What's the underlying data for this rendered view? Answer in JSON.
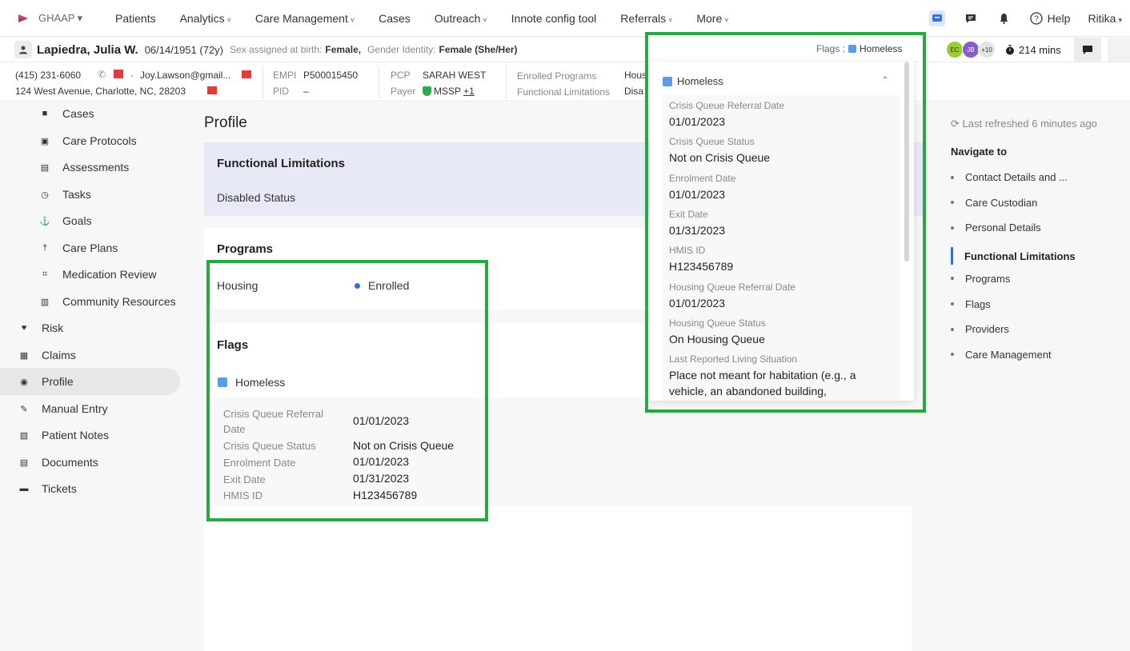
{
  "nav": {
    "brand": "GHAAP",
    "items": [
      {
        "label": "Patients",
        "caret": false
      },
      {
        "label": "Analytics",
        "caret": true
      },
      {
        "label": "Care Management",
        "caret": true
      },
      {
        "label": "Cases",
        "caret": false
      },
      {
        "label": "Outreach",
        "caret": true
      },
      {
        "label": "Innote config tool",
        "caret": false
      },
      {
        "label": "Referrals",
        "caret": true
      },
      {
        "label": "More",
        "caret": true
      }
    ],
    "help": "Help",
    "user": "Ritika"
  },
  "patient": {
    "name": "Lapiedra, Julia W.",
    "dob": "06/14/1951 (72y)",
    "sex_label": "Sex assigned at birth:",
    "sex_value": "Female,",
    "gender_label": "Gender Identity:",
    "gender_value": "Female (She/Her)",
    "flags_label": "Flags :",
    "flags_value": "Homeless",
    "assignees": [
      "EC",
      "JB",
      "+10"
    ],
    "minutes": "214 mins"
  },
  "contact": {
    "phone": "(415) 231-6060",
    "email": "Joy.Lawson@gmail...",
    "address": "124 West Avenue, Charlotte, NC, 28203",
    "empi_label": "EMPI",
    "empi_value": "P500015450",
    "pid_label": "PID",
    "pid_value": "–",
    "pcp_label": "PCP",
    "pcp_value": "SARAH WEST",
    "payer_label": "Payer",
    "payer_value": "MSSP",
    "payer_more": "+1",
    "enrolled_label": "Enrolled Programs",
    "enrolled_value": "Hous",
    "fl_label": "Functional Limitations",
    "fl_value": "Disa"
  },
  "sidebar": {
    "items": [
      {
        "label": "Cases",
        "icon": "folder-icon",
        "indent": true
      },
      {
        "label": "Care Protocols",
        "icon": "protocol-icon",
        "indent": true
      },
      {
        "label": "Assessments",
        "icon": "clipboard-icon",
        "indent": true
      },
      {
        "label": "Tasks",
        "icon": "clock-icon",
        "indent": true
      },
      {
        "label": "Goals",
        "icon": "goal-icon",
        "indent": true
      },
      {
        "label": "Care Plans",
        "icon": "person-icon",
        "indent": true
      },
      {
        "label": "Medication Review",
        "icon": "medication-icon",
        "indent": true
      },
      {
        "label": "Community Resources",
        "icon": "building-icon",
        "indent": true
      },
      {
        "label": "Risk",
        "icon": "heart-icon",
        "indent": false
      },
      {
        "label": "Claims",
        "icon": "claims-icon",
        "indent": false
      },
      {
        "label": "Profile",
        "icon": "profile-icon",
        "indent": false
      },
      {
        "label": "Manual Entry",
        "icon": "pencil-icon",
        "indent": false
      },
      {
        "label": "Patient Notes",
        "icon": "notes-icon",
        "indent": false
      },
      {
        "label": "Documents",
        "icon": "document-icon",
        "indent": false
      },
      {
        "label": "Tickets",
        "icon": "ticket-icon",
        "indent": false
      }
    ]
  },
  "main": {
    "title": "Profile",
    "functional": {
      "title": "Functional Limitations",
      "value": "Disabled Status"
    },
    "programs": {
      "title": "Programs",
      "name": "Housing",
      "status": "Enrolled"
    },
    "flags": {
      "title": "Flags",
      "flag": "Homeless",
      "rows": [
        {
          "label": "Crisis Queue Referral Date",
          "value": "01/01/2023"
        },
        {
          "label": "Crisis Queue Status",
          "value": "Not on Crisis Queue"
        },
        {
          "label": "Enrolment Date",
          "value": "01/01/2023"
        },
        {
          "label": "Exit Date",
          "value": "01/31/2023"
        },
        {
          "label": "HMIS ID",
          "value": "H123456789"
        }
      ]
    }
  },
  "popover": {
    "flag": "Homeless",
    "rows": [
      {
        "label": "Crisis Queue Referral Date",
        "value": "01/01/2023"
      },
      {
        "label": "Crisis Queue Status",
        "value": "Not on Crisis Queue"
      },
      {
        "label": "Enrolment Date",
        "value": "01/01/2023"
      },
      {
        "label": "Exit Date",
        "value": "01/31/2023"
      },
      {
        "label": "HMIS ID",
        "value": "H123456789"
      },
      {
        "label": "Housing Queue Referral Date",
        "value": "01/01/2023"
      },
      {
        "label": "Housing Queue Status",
        "value": "On Housing Queue"
      },
      {
        "label": "Last Reported Living Situation",
        "value": "Place not meant for habitation (e.g., a vehicle, an abandoned building,"
      }
    ]
  },
  "rightnav": {
    "refreshed": "Last refreshed 6 minutes ago",
    "title": "Navigate to",
    "items": [
      {
        "label": "Contact Details and ...",
        "active": false
      },
      {
        "label": "Care Custodian",
        "active": false
      },
      {
        "label": "Personal Details",
        "active": false
      },
      {
        "label": "Functional Limitations",
        "active": true
      },
      {
        "label": "Programs",
        "active": false
      },
      {
        "label": "Flags",
        "active": false
      },
      {
        "label": "Providers",
        "active": false
      },
      {
        "label": "Care Management",
        "active": false
      }
    ]
  },
  "colors": {
    "highlight": "#2aa745",
    "accent": "#2f6fd6",
    "flag": "#5b9be8"
  }
}
